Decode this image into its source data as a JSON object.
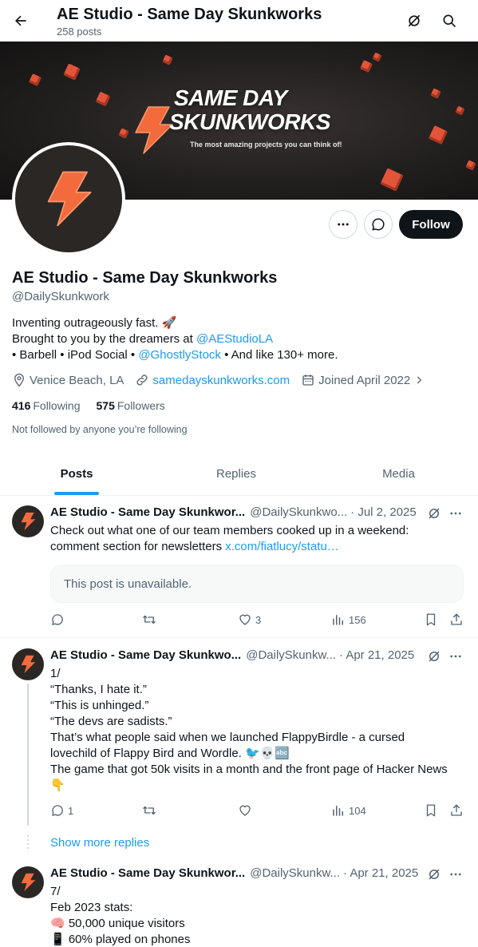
{
  "header": {
    "title": "AE Studio - Same Day Skunkworks",
    "posts_count": "258 posts"
  },
  "banner": {
    "title_line1": "SAME DAY",
    "title_line2": "SKUNKWORKS",
    "tagline": "The most amazing projects you can think of!"
  },
  "profile": {
    "name": "AE Studio - Same Day Skunkworks",
    "handle": "@DailySkunkwork",
    "bio_line1": "Inventing outrageously fast. 🚀",
    "bio_line2_prefix": "Brought to you by the dreamers at ",
    "bio_line2_link": "@AEStudioLA",
    "bio_line3_prefix": "• Barbell • iPod Social • ",
    "bio_line3_link": "@GhostlyStock",
    "bio_line3_suffix": " • And like 130+ more.",
    "location": "Venice Beach, LA",
    "website": "samedayskunkworks.com",
    "joined": "Joined April 2022",
    "following_count": "416",
    "following_label": "Following",
    "followers_count": "575",
    "followers_label": "Followers",
    "not_followed": "Not followed by anyone you’re following",
    "follow_label": "Follow"
  },
  "tabs": [
    {
      "label": "Posts",
      "active": true
    },
    {
      "label": "Replies",
      "active": false
    },
    {
      "label": "Media",
      "active": false
    }
  ],
  "posts": [
    {
      "name": "AE Studio - Same Day Skunkwor...",
      "handle": "@DailySkunkwo...",
      "date": "· Jul 2, 2025",
      "text_line1": "Check out what one of our team members cooked up in a weekend:",
      "text_line2_prefix": "comment section for newsletters ",
      "text_line2_link": "x.com/fiatlucy/statu…",
      "quote": "This post is unavailable.",
      "replies": "",
      "reposts": "",
      "likes": "3",
      "views": "156"
    },
    {
      "name": "AE Studio - Same Day Skunkwo...",
      "handle": "@DailySkunkw...",
      "date": "· Apr 21, 2025",
      "lines": [
        "1/",
        "“Thanks, I hate it.”",
        "“This is unhinged.”",
        "“The devs are sadists.”",
        "That’s what people said when we launched FlappyBirdle - a cursed",
        "lovechild of Flappy Bird and Wordle. 🐦💀🔤",
        "The game that got 50k visits in a month and the front page of Hacker News",
        "👇"
      ],
      "replies": "1",
      "reposts": "",
      "likes": "",
      "views": "104"
    },
    {
      "name": "AE Studio - Same Day Skunkwor...",
      "handle": "@DailySkunkw...",
      "date": "· Apr 21, 2025",
      "lines": [
        "7/",
        "Feb 2023 stats:",
        "🧠 50,000 unique visitors",
        "📱 60% played on phones"
      ]
    }
  ],
  "show_more_replies": "Show more replies",
  "colors": {
    "accent": "#1d9bf0",
    "text": "#0f1419",
    "secondary": "#536471",
    "brand_orange": "#f36a3d"
  }
}
